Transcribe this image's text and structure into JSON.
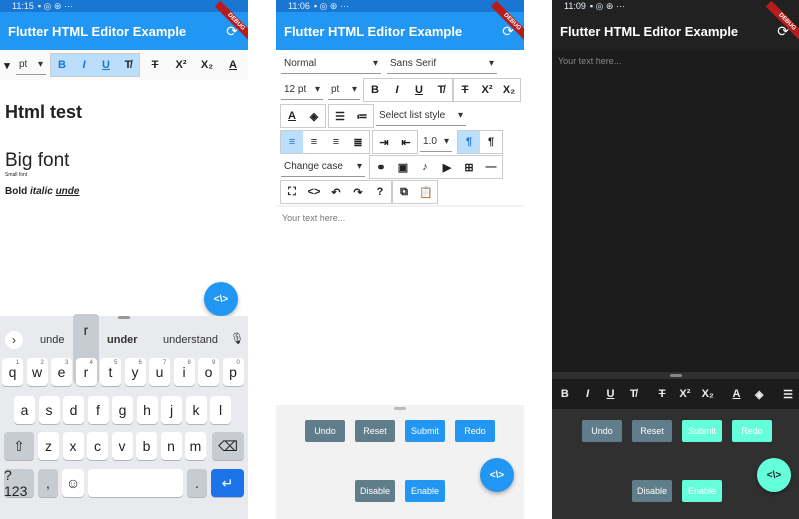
{
  "app": {
    "title": "Flutter HTML Editor Example",
    "debug_label": "DEBUG",
    "fab_label": "<\\>"
  },
  "phone1": {
    "time": "11:15",
    "toolbar": {
      "size_value": "pt"
    },
    "content": {
      "heading": "Html test",
      "big": "Big font",
      "small": "Small font",
      "bold": "Bold",
      "italic": "italic",
      "underline": "unde"
    },
    "suggestions": [
      "unde",
      "under",
      "understand"
    ],
    "popup_key": "r",
    "rows": [
      [
        "q",
        "w",
        "e",
        "r",
        "t",
        "y",
        "u",
        "i",
        "o",
        "p"
      ],
      [
        "a",
        "s",
        "d",
        "f",
        "g",
        "h",
        "j",
        "k",
        "l"
      ],
      [
        "z",
        "x",
        "c",
        "v",
        "b",
        "n",
        "m"
      ]
    ],
    "numbers": [
      "1",
      "2",
      "3",
      "4",
      "5",
      "6",
      "7",
      "8",
      "9",
      "0"
    ],
    "sym_label": "?123",
    "comma": ",",
    "period": "."
  },
  "phone2": {
    "time": "11:06",
    "style_value": "Normal",
    "font_value": "Sans Serif",
    "size_value": "12 pt",
    "unit_value": "pt",
    "list_style": "Select list style",
    "line_height": "1.0",
    "change_case": "Change case",
    "placeholder": "Your text here...",
    "buttons": {
      "undo": "Undo",
      "reset": "Reset",
      "submit": "Submit",
      "redo": "Redo",
      "disable": "Disable",
      "enable": "Enable"
    }
  },
  "phone3": {
    "time": "11:09",
    "placeholder": "Your text here...",
    "buttons": {
      "undo": "Undo",
      "reset": "Reset",
      "submit": "Submit",
      "redo": "Redo",
      "disable": "Disable",
      "enable": "Enable"
    }
  },
  "colors": {
    "primary": "#2196f3",
    "button_gray": "#607d8b",
    "teal": "#64ffda",
    "dark": "#1f1f1f"
  }
}
